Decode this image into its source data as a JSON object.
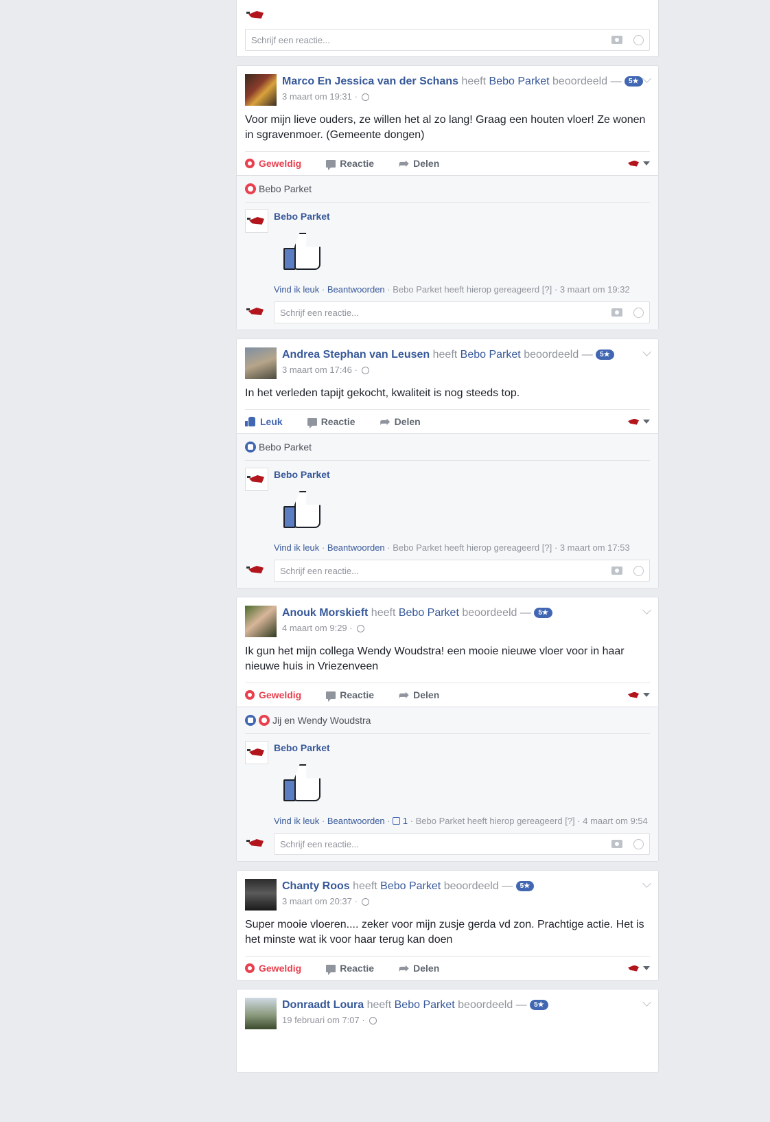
{
  "colors": {
    "link": "#365899",
    "accent": "#4267b2",
    "love": "#e9404f",
    "bg": "#e9ebee"
  },
  "reply_placeholder": "Schrijf een reactie...",
  "verb": "heeft",
  "page": "Bebo Parket",
  "rated": "beoordeeld",
  "dash": "—",
  "stars": "5★",
  "actions": {
    "love": "Geweldig",
    "like": "Leuk",
    "comment": "Reactie",
    "share": "Delen"
  },
  "comment_links": {
    "like": "Vind ik leuk",
    "reply": "Beantwoorden",
    "reacted": "Bebo Parket heeft hierop gereageerd",
    "help": "[?]"
  },
  "posts": [
    {
      "author": "Marco En Jessica van der Schans",
      "time": "3 maart om 19:31",
      "text": "Voor mijn lieve ouders, ze willen het al zo lang! Graag een houten vloer! Ze wonen in sgravenmoer. (Gemeente dongen)",
      "reaction_kind": "love",
      "reacted_by": "Bebo Parket",
      "comment_author": "Bebo Parket",
      "comment_time": "3 maart om 19:32"
    },
    {
      "author": "Andrea Stephan van Leusen",
      "time": "3 maart om 17:46",
      "text": "In het verleden tapijt gekocht, kwaliteit is nog steeds top.",
      "reaction_kind": "like",
      "reacted_by": "Bebo Parket",
      "comment_author": "Bebo Parket",
      "comment_time": "3 maart om 17:53"
    },
    {
      "author": "Anouk Morskieft",
      "time": "4 maart om 9:29",
      "text": "Ik gun het mijn collega Wendy Woudstra! een mooie nieuwe vloer voor in haar nieuwe huis in Vriezenveen",
      "reaction_kind": "love",
      "reacted_by": "Jij en Wendy Woudstra",
      "comment_author": "Bebo Parket",
      "comment_like_count": "1",
      "comment_time": "4 maart om 9:54"
    },
    {
      "author": "Chanty Roos",
      "time": "3 maart om 20:37",
      "text": "Super mooie vloeren.... zeker voor mijn zusje gerda vd zon. Prachtige actie. Het is het minste wat ik voor haar terug kan doen",
      "reaction_kind": "love"
    },
    {
      "author": "Donraadt Loura",
      "time": "19 februari om 7:07"
    }
  ]
}
